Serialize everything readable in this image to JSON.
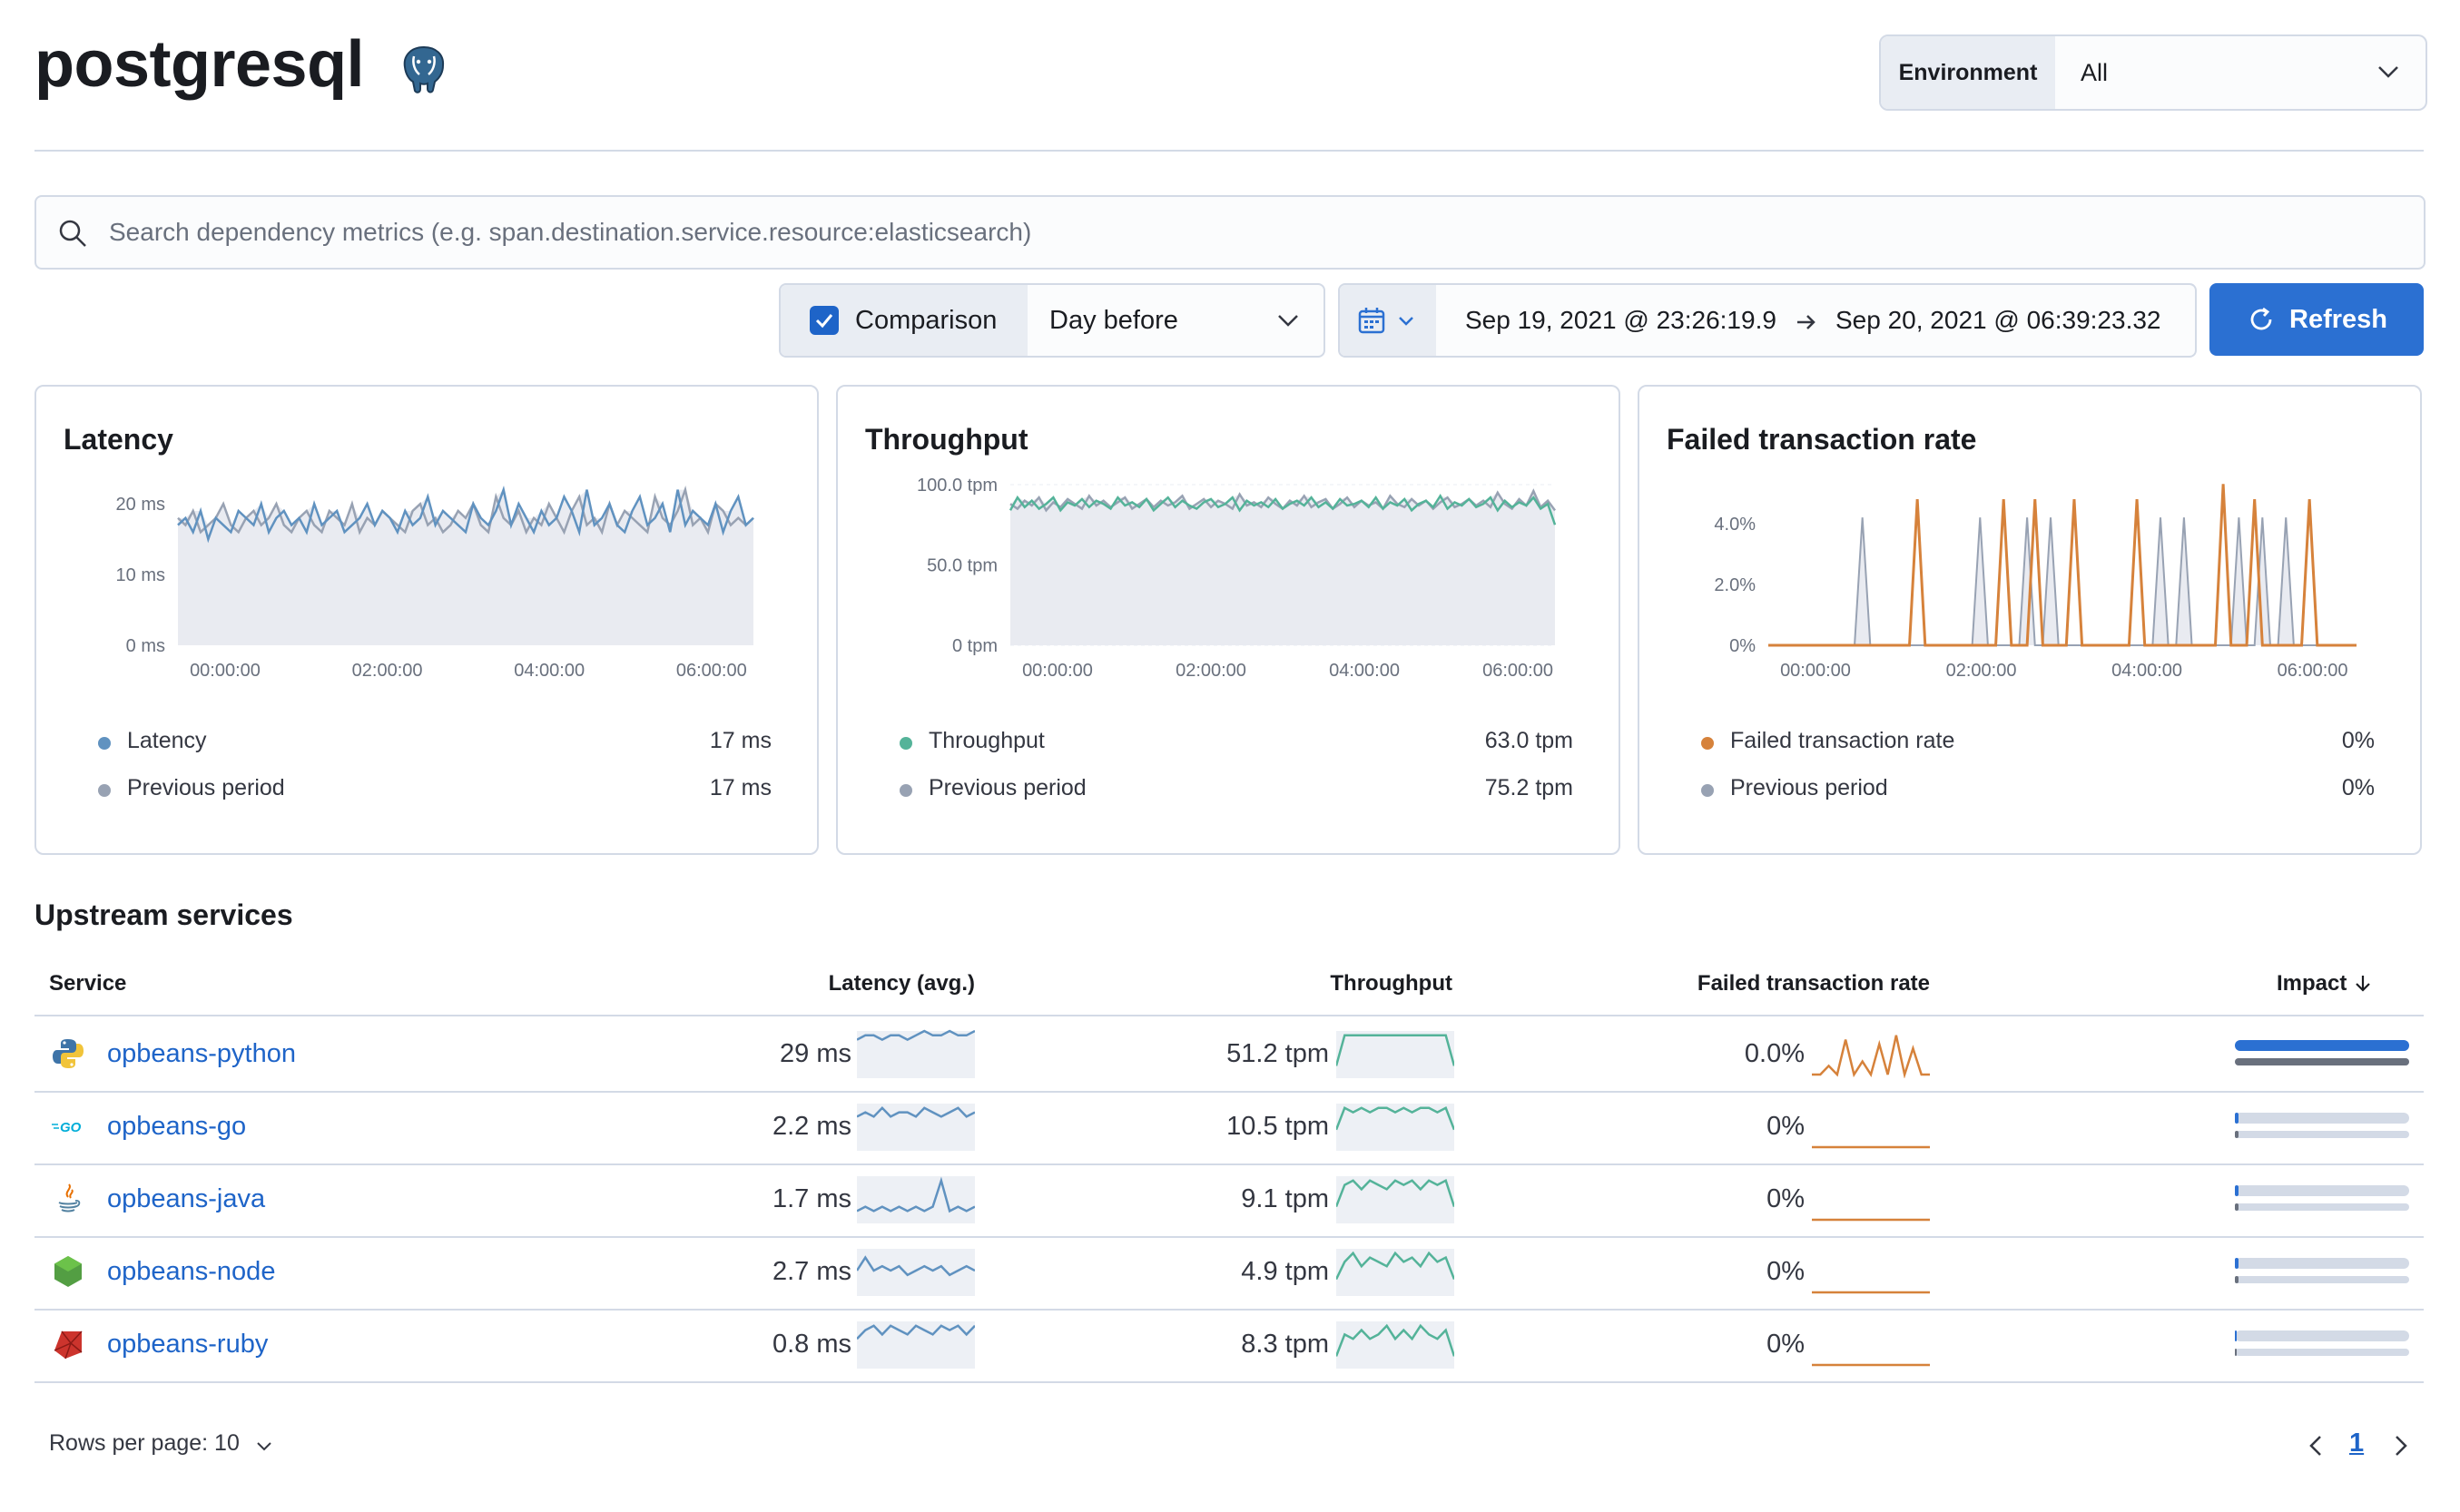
{
  "page": {
    "title": "postgresql",
    "icon": "postgresql-elephant-icon"
  },
  "environment": {
    "label": "Environment",
    "value": "All"
  },
  "search": {
    "placeholder": "Search dependency metrics (e.g. span.destination.service.resource:elasticsearch)"
  },
  "comparison": {
    "checkbox_label": "Comparison",
    "checked": true,
    "selected": "Day before"
  },
  "date_picker": {
    "start": "Sep 19, 2021 @ 23:26:19.9",
    "end": "Sep 20, 2021 @ 06:39:23.32"
  },
  "refresh_label": "Refresh",
  "colors": {
    "accent": "#2b70d2",
    "latency": "#6092c0",
    "throughput": "#54b399",
    "failed": "#d6823b",
    "previous": "#98a2b3"
  },
  "panels": {
    "latency": {
      "title": "Latency",
      "legend": [
        {
          "label": "Latency",
          "value": "17 ms"
        },
        {
          "label": "Previous period",
          "value": "17 ms"
        }
      ]
    },
    "throughput": {
      "title": "Throughput",
      "legend": [
        {
          "label": "Throughput",
          "value": "63.0 tpm"
        },
        {
          "label": "Previous period",
          "value": "75.2 tpm"
        }
      ]
    },
    "failed": {
      "title": "Failed transaction rate",
      "legend": [
        {
          "label": "Failed transaction rate",
          "value": "0%"
        },
        {
          "label": "Previous period",
          "value": "0%"
        }
      ]
    }
  },
  "chart_data": [
    {
      "type": "area",
      "x_ticks": [
        "00:00:00",
        "02:00:00",
        "04:00:00",
        "06:00:00"
      ],
      "y_ticks": [
        "0 ms",
        "10 ms",
        "20 ms"
      ],
      "ylim": [
        0,
        24
      ],
      "series": [
        {
          "name": "Latency",
          "values": [
            17,
            18,
            16,
            19,
            15,
            18,
            17,
            16,
            19,
            18,
            17,
            20,
            16,
            18,
            19,
            17,
            18,
            16,
            20,
            17,
            18,
            19,
            16,
            17,
            18,
            20,
            17,
            19,
            18,
            16,
            19,
            17,
            18,
            21,
            17,
            19,
            18,
            17,
            16,
            20,
            18,
            17,
            19,
            22,
            17,
            20,
            18,
            16,
            19,
            17,
            18,
            21,
            19,
            16,
            22,
            17,
            18,
            20,
            17,
            16,
            19,
            21,
            17,
            18,
            20,
            16,
            22,
            17,
            19,
            18,
            17,
            20,
            16,
            19,
            21,
            17,
            18
          ]
        },
        {
          "name": "Previous period",
          "values": [
            18,
            17,
            19,
            16,
            17,
            18,
            20,
            17,
            16,
            18,
            19,
            17,
            18,
            20,
            17,
            16,
            18,
            19,
            17,
            16,
            19,
            18,
            17,
            20,
            16,
            18,
            17,
            19,
            18,
            17,
            16,
            19,
            20,
            17,
            18,
            16,
            17,
            19,
            18,
            20,
            17,
            16,
            21,
            18,
            17,
            19,
            16,
            18,
            17,
            20,
            18,
            16,
            19,
            21,
            17,
            18,
            16,
            20,
            17,
            19,
            18,
            17,
            16,
            21,
            18,
            17,
            19,
            22,
            17,
            18,
            16,
            20,
            19,
            17,
            18,
            17,
            18
          ]
        }
      ]
    },
    {
      "type": "area",
      "x_ticks": [
        "00:00:00",
        "02:00:00",
        "04:00:00",
        "06:00:00"
      ],
      "y_ticks": [
        "0 tpm",
        "50.0 tpm",
        "100.0 tpm"
      ],
      "ylim": [
        0,
        100
      ],
      "series": [
        {
          "name": "Throughput",
          "values": [
            84,
            92,
            86,
            90,
            85,
            88,
            92,
            84,
            89,
            87,
            91,
            86,
            90,
            88,
            85,
            92,
            87,
            89,
            86,
            91,
            84,
            88,
            92,
            86,
            90,
            87,
            85,
            89,
            91,
            86,
            88,
            92,
            84,
            90,
            87,
            89,
            86,
            91,
            85,
            88,
            90,
            87,
            92,
            86,
            89,
            85,
            91,
            87,
            88,
            90,
            86,
            92,
            85,
            89,
            87,
            91,
            84,
            88,
            90,
            86,
            93,
            85,
            89,
            87,
            91,
            86,
            88,
            92,
            84,
            90,
            86,
            89,
            87,
            92,
            85,
            88,
            75
          ]
        },
        {
          "name": "Previous period",
          "values": [
            88,
            85,
            90,
            87,
            92,
            84,
            89,
            86,
            91,
            88,
            85,
            93,
            87,
            90,
            86,
            89,
            92,
            85,
            88,
            91,
            86,
            90,
            87,
            89,
            93,
            85,
            88,
            91,
            86,
            90,
            88,
            85,
            94,
            87,
            89,
            86,
            92,
            88,
            85,
            90,
            87,
            93,
            86,
            89,
            91,
            85,
            88,
            92,
            86,
            90,
            87,
            89,
            85,
            93,
            88,
            86,
            91,
            87,
            90,
            85,
            89,
            92,
            86,
            88,
            91,
            87,
            90,
            86,
            95,
            88,
            85,
            91,
            87,
            96,
            86,
            90,
            84
          ]
        }
      ]
    },
    {
      "type": "line",
      "x_ticks": [
        "00:00:00",
        "02:00:00",
        "04:00:00",
        "06:00:00"
      ],
      "y_ticks": [
        "0%",
        "2.0%",
        "4.0%"
      ],
      "ylim": [
        0,
        5.4
      ],
      "series": [
        {
          "name": "Failed transaction rate",
          "values": [
            0,
            0,
            0,
            0,
            0,
            0,
            0,
            0,
            0,
            0,
            0,
            0,
            0,
            0,
            0,
            0,
            0,
            0,
            0,
            4.8,
            0,
            0,
            0,
            0,
            0,
            0,
            0,
            0,
            0,
            0,
            4.8,
            0,
            0,
            0,
            4.8,
            0,
            0,
            0,
            0,
            4.8,
            0,
            0,
            0,
            0,
            0,
            0,
            0,
            4.8,
            0,
            0,
            0,
            0,
            0,
            0,
            0,
            0,
            0,
            0,
            5.3,
            0,
            0,
            0,
            4.8,
            0,
            0,
            0,
            0,
            0,
            0,
            4.8,
            0,
            0,
            0,
            0,
            0,
            0
          ]
        },
        {
          "name": "Previous period",
          "values": [
            0,
            0,
            0,
            0,
            0,
            0,
            0,
            0,
            0,
            0,
            0,
            0,
            4.2,
            0,
            0,
            0,
            0,
            0,
            0,
            0,
            0,
            0,
            0,
            0,
            0,
            0,
            0,
            4.2,
            0,
            0,
            0,
            0,
            0,
            4.2,
            0,
            0,
            4.2,
            0,
            0,
            0,
            0,
            0,
            0,
            0,
            0,
            0,
            0,
            0,
            0,
            0,
            4.2,
            0,
            0,
            4.2,
            0,
            0,
            0,
            0,
            0,
            0,
            4.2,
            0,
            0,
            4.2,
            0,
            0,
            4.2,
            0,
            0,
            0,
            0,
            0,
            0,
            0,
            0,
            0
          ]
        }
      ]
    }
  ],
  "upstream": {
    "title": "Upstream services",
    "columns": {
      "service": "Service",
      "latency": "Latency (avg.)",
      "throughput": "Throughput",
      "failed": "Failed transaction rate",
      "impact": "Impact"
    },
    "rows": [
      {
        "service": "opbeans-python",
        "icon": "python-icon",
        "latency": "29 ms",
        "throughput": "51.2 tpm",
        "failed": "0.0%",
        "impact": 1.0,
        "spark_lat": [
          8,
          9,
          9,
          8,
          9,
          9,
          8,
          9,
          10,
          9,
          9,
          10,
          9,
          9,
          10
        ],
        "spark_thr": [
          2,
          9,
          9,
          9,
          9,
          9,
          9,
          9,
          9,
          9,
          9,
          9,
          9,
          9,
          2
        ],
        "spark_fail": [
          0,
          0,
          2,
          0,
          8,
          0,
          3,
          0,
          7,
          0,
          9,
          0,
          6,
          0,
          0
        ]
      },
      {
        "service": "opbeans-go",
        "icon": "go-icon",
        "latency": "2.2 ms",
        "throughput": "10.5 tpm",
        "failed": "0%",
        "impact": 0.02,
        "spark_lat": [
          7,
          8,
          7,
          9,
          7,
          8,
          8,
          7,
          9,
          8,
          7,
          8,
          9,
          7,
          8
        ],
        "spark_thr": [
          4,
          9,
          8,
          9,
          8,
          9,
          9,
          8,
          9,
          8,
          9,
          9,
          8,
          9,
          4
        ],
        "spark_fail": [
          0,
          0,
          0,
          0,
          0,
          0,
          0,
          0,
          0,
          0,
          0,
          0,
          0,
          0,
          0
        ]
      },
      {
        "service": "opbeans-java",
        "icon": "java-icon",
        "latency": "1.7 ms",
        "throughput": "9.1 tpm",
        "failed": "0%",
        "impact": 0.02,
        "spark_lat": [
          2,
          3,
          2,
          3,
          2,
          3,
          2,
          3,
          2,
          3,
          9,
          2,
          3,
          2,
          3
        ],
        "spark_thr": [
          3,
          8,
          9,
          7,
          9,
          8,
          7,
          9,
          8,
          9,
          7,
          9,
          8,
          9,
          3
        ],
        "spark_fail": [
          0,
          0,
          0,
          0,
          0,
          0,
          0,
          0,
          0,
          0,
          0,
          0,
          0,
          0,
          0
        ]
      },
      {
        "service": "opbeans-node",
        "icon": "node-icon",
        "latency": "2.7 ms",
        "throughput": "4.9 tpm",
        "failed": "0%",
        "impact": 0.02,
        "spark_lat": [
          5,
          8,
          5,
          6,
          5,
          6,
          4,
          5,
          6,
          5,
          6,
          4,
          5,
          6,
          5
        ],
        "spark_thr": [
          3,
          7,
          9,
          6,
          8,
          7,
          6,
          9,
          7,
          8,
          6,
          9,
          7,
          8,
          3
        ],
        "spark_fail": [
          0,
          0,
          0,
          0,
          0,
          0,
          0,
          0,
          0,
          0,
          0,
          0,
          0,
          0,
          0
        ]
      },
      {
        "service": "opbeans-ruby",
        "icon": "ruby-icon",
        "latency": "0.8 ms",
        "throughput": "8.3 tpm",
        "failed": "0%",
        "impact": 0.0,
        "spark_lat": [
          6,
          8,
          9,
          7,
          9,
          8,
          7,
          9,
          8,
          7,
          9,
          8,
          9,
          7,
          9
        ],
        "spark_thr": [
          2,
          7,
          6,
          8,
          6,
          7,
          9,
          6,
          8,
          6,
          9,
          7,
          6,
          8,
          2
        ],
        "spark_fail": [
          0,
          0,
          0,
          0,
          0,
          0,
          0,
          0,
          0,
          0,
          0,
          0,
          0,
          0,
          0
        ]
      }
    ]
  },
  "pagination": {
    "rows_per_page": "Rows per page: 10",
    "current_page": "1"
  }
}
